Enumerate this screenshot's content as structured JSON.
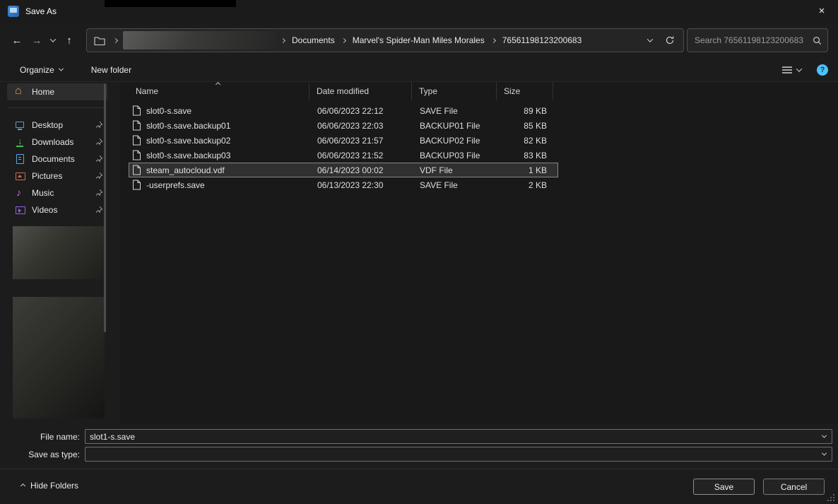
{
  "window": {
    "title": "Save As",
    "close_glyph": "×"
  },
  "toolbar": {
    "back_glyph": "←",
    "forward_glyph": "→",
    "up_glyph": "↑",
    "breadcrumb": {
      "segments": [
        {
          "label": "Documents"
        },
        {
          "label": "Marvel's Spider-Man Miles Morales"
        },
        {
          "label": "76561198123200683"
        }
      ]
    },
    "search": {
      "placeholder": "Search 76561198123200683"
    }
  },
  "command_bar": {
    "organize": "Organize",
    "new_folder": "New folder",
    "help_glyph": "?"
  },
  "sidebar": {
    "home": {
      "label": "Home"
    },
    "items": [
      {
        "label": "Desktop",
        "icon": "desktop",
        "pinned": true
      },
      {
        "label": "Downloads",
        "icon": "downloads",
        "pinned": true
      },
      {
        "label": "Documents",
        "icon": "documents",
        "pinned": true
      },
      {
        "label": "Pictures",
        "icon": "pictures",
        "pinned": true
      },
      {
        "label": "Music",
        "icon": "music",
        "pinned": true
      },
      {
        "label": "Videos",
        "icon": "videos",
        "pinned": true
      }
    ]
  },
  "file_list": {
    "columns": {
      "name": "Name",
      "date": "Date modified",
      "type": "Type",
      "size": "Size"
    },
    "rows": [
      {
        "name": "slot0-s.save",
        "date": "06/06/2023 22:12",
        "type": "SAVE File",
        "size": "89 KB"
      },
      {
        "name": "slot0-s.save.backup01",
        "date": "06/06/2023 22:03",
        "type": "BACKUP01 File",
        "size": "85 KB"
      },
      {
        "name": "slot0-s.save.backup02",
        "date": "06/06/2023 21:57",
        "type": "BACKUP02 File",
        "size": "82 KB"
      },
      {
        "name": "slot0-s.save.backup03",
        "date": "06/06/2023 21:52",
        "type": "BACKUP03 File",
        "size": "83 KB"
      },
      {
        "name": "steam_autocloud.vdf",
        "date": "06/14/2023 00:02",
        "type": "VDF File",
        "size": "1 KB",
        "selected": true
      },
      {
        "name": "-userprefs.save",
        "date": "06/13/2023 22:30",
        "type": "SAVE File",
        "size": "2 KB"
      }
    ]
  },
  "footer": {
    "file_name_label": "File name:",
    "file_name_value": "slot1-s.save",
    "save_as_type_label": "Save as type:",
    "save_as_type_value": "",
    "hide_folders": "Hide Folders",
    "save": "Save",
    "cancel": "Cancel"
  },
  "colors": {
    "help_accent": "#4cc2ff",
    "selection_border": "#888888",
    "window_bg": "#1c1c1c",
    "pane_bg": "#191919"
  }
}
